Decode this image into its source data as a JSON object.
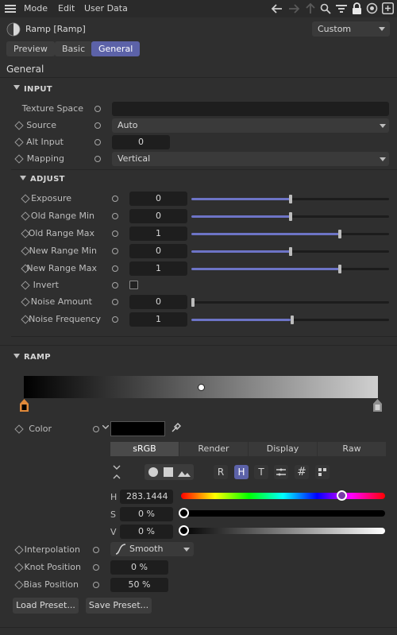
{
  "menubar": {
    "items": [
      "Mode",
      "Edit",
      "User Data"
    ]
  },
  "header": {
    "title": "Ramp [Ramp]",
    "preset_value": "Custom"
  },
  "tabs": [
    {
      "label": "Preview",
      "active": false
    },
    {
      "label": "Basic",
      "active": false
    },
    {
      "label": "General",
      "active": true
    }
  ],
  "section_title": "General",
  "input_group": {
    "title": "INPUT",
    "texture_space": {
      "label": "Texture Space",
      "value": ""
    },
    "source": {
      "label": "Source",
      "value": "Auto"
    },
    "alt_input": {
      "label": "Alt Input",
      "value": "0"
    },
    "mapping": {
      "label": "Mapping",
      "value": "Vertical"
    }
  },
  "adjust_group": {
    "title": "ADJUST",
    "rows": [
      {
        "label": "Exposure",
        "value": "0",
        "slider": 0.5
      },
      {
        "label": "Old Range Min",
        "value": "0",
        "slider": 0.5
      },
      {
        "label": "Old Range Max",
        "value": "1",
        "slider": 0.75
      },
      {
        "label": "New Range Min",
        "value": "0",
        "slider": 0.5
      },
      {
        "label": "New Range Max",
        "value": "1",
        "slider": 0.75
      }
    ],
    "invert": {
      "label": "Invert",
      "checked": false
    },
    "noise_amount": {
      "label": "Noise Amount",
      "value": "0",
      "slider": 0.0
    },
    "noise_frequency": {
      "label": "Noise Frequency",
      "value": "1",
      "slider": 0.5
    }
  },
  "ramp_group": {
    "title": "RAMP",
    "gradient": {
      "start": "#000000",
      "end": "#d0d0d0",
      "midpoint": 0.5
    },
    "color": {
      "label": "Color",
      "swatch": "#000000"
    },
    "color_modes": [
      "sRGB",
      "Render",
      "Display",
      "Raw"
    ],
    "active_mode": "sRGB",
    "channel_buttons": [
      "R",
      "H",
      "T"
    ],
    "hsv": {
      "h_label": "H",
      "h_value": "283.1444",
      "h_level": 0.787,
      "s_label": "S",
      "s_value": "0 %",
      "s_level": 0.0,
      "v_label": "V",
      "v_value": "0 %",
      "v_level": 0.0
    },
    "interpolation": {
      "label": "Interpolation",
      "value": "Smooth"
    },
    "knot_position": {
      "label": "Knot Position",
      "value": "0 %"
    },
    "bias_position": {
      "label": "Bias Position",
      "value": "50 %"
    }
  },
  "buttons": {
    "load_preset": "Load Preset...",
    "save_preset": "Save Preset..."
  },
  "colors": {
    "accent": "#5c62a8",
    "slider_fill": "#6d74c6",
    "knot_active": "#e0893a"
  }
}
